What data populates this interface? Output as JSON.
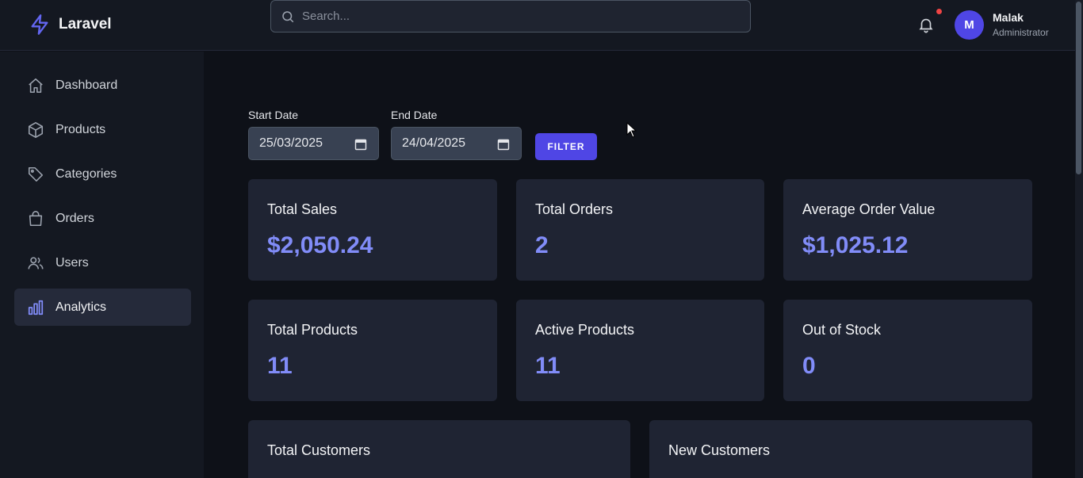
{
  "app": {
    "brand": "Laravel",
    "accent_color": "#4f46e5",
    "value_color": "#818cf8"
  },
  "search": {
    "placeholder": "Search..."
  },
  "user": {
    "initial": "M",
    "name": "Malak",
    "role": "Administrator",
    "notification_indicator": "red-dot"
  },
  "sidebar": {
    "items": [
      {
        "label": "Dashboard",
        "icon": "home-icon"
      },
      {
        "label": "Products",
        "icon": "cube-icon"
      },
      {
        "label": "Categories",
        "icon": "tag-icon"
      },
      {
        "label": "Orders",
        "icon": "shopping-bag-icon"
      },
      {
        "label": "Users",
        "icon": "users-icon"
      },
      {
        "label": "Analytics",
        "icon": "bar-chart-icon",
        "active": true
      }
    ]
  },
  "filters": {
    "start_label": "Start Date",
    "start_value": "25/03/2025",
    "end_label": "End Date",
    "end_value": "24/04/2025",
    "button_label": "FILTER"
  },
  "stats": [
    {
      "title": "Total Sales",
      "value": "$2,050.24"
    },
    {
      "title": "Total Orders",
      "value": "2"
    },
    {
      "title": "Average Order Value",
      "value": "$1,025.12"
    },
    {
      "title": "Total Products",
      "value": "11"
    },
    {
      "title": "Active Products",
      "value": "11"
    },
    {
      "title": "Out of Stock",
      "value": "0"
    },
    {
      "title": "Total Customers",
      "value": ""
    },
    {
      "title": "New Customers",
      "value": ""
    }
  ]
}
